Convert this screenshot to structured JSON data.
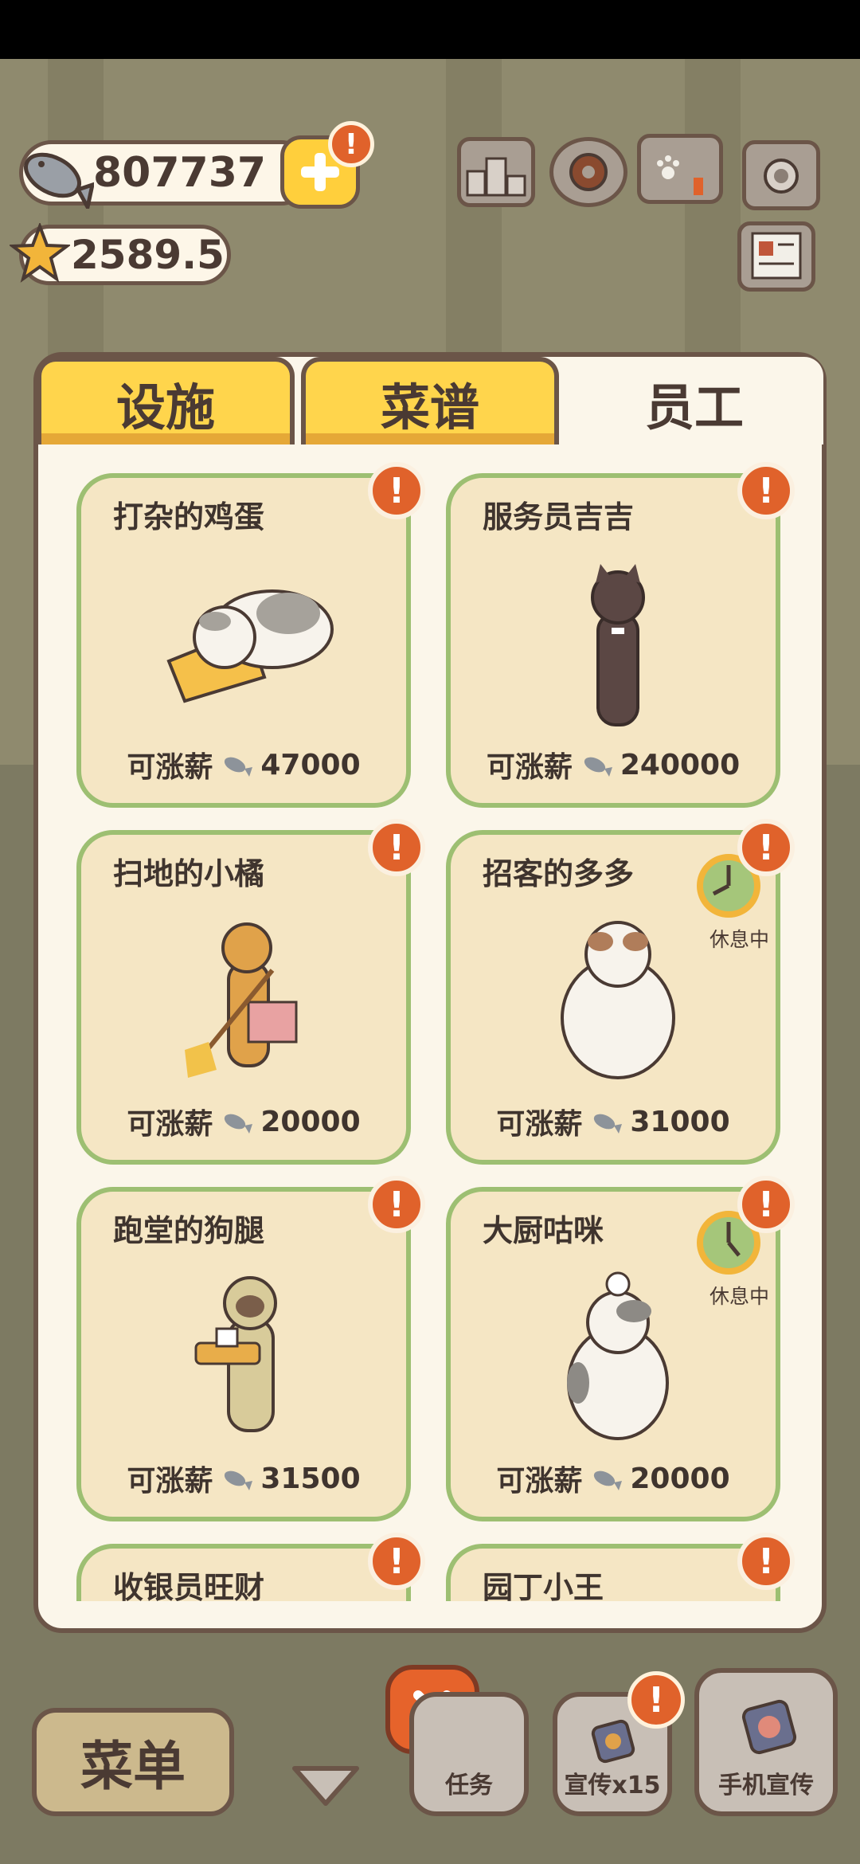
{
  "hud": {
    "fish_count": "807737",
    "star_count": "2589.5",
    "alert_mark": "!"
  },
  "tabs": [
    {
      "label": "设施",
      "active": false
    },
    {
      "label": "菜谱",
      "active": false
    },
    {
      "label": "员工",
      "active": true
    }
  ],
  "staff": [
    {
      "name": "打杂的鸡蛋",
      "salary_label": "可涨薪",
      "salary": "47000",
      "resting": false,
      "icon": "cat-on-mop-icon"
    },
    {
      "name": "服务员吉吉",
      "salary_label": "可涨薪",
      "salary": "240000",
      "resting": false,
      "icon": "waiter-cat-icon"
    },
    {
      "name": "扫地的小橘",
      "salary_label": "可涨薪",
      "salary": "20000",
      "resting": false,
      "icon": "sweeping-cat-icon"
    },
    {
      "name": "招客的多多",
      "salary_label": "可涨薪",
      "salary": "31000",
      "resting": true,
      "rest_label": "休息中",
      "icon": "fluffy-cat-icon"
    },
    {
      "name": "跑堂的狗腿",
      "salary_label": "可涨薪",
      "salary": "31500",
      "resting": false,
      "icon": "serving-cat-icon"
    },
    {
      "name": "大厨咕咪",
      "salary_label": "可涨薪",
      "salary": "20000",
      "resting": true,
      "rest_label": "休息中",
      "icon": "chef-cat-icon"
    },
    {
      "name": "收银员旺财",
      "partial": true
    },
    {
      "name": "园丁小王",
      "partial": true
    }
  ],
  "bottom": {
    "menu_label": "菜单",
    "tasks_label": "任务",
    "promo_label": "宣传x15",
    "phone_promo_label": "手机宣传"
  },
  "colors": {
    "panel_bg": "#fbf6ea",
    "card_bg": "#f5e6c4",
    "card_border": "#9dbf72",
    "tab_yellow": "#ffd54c",
    "alert_orange": "#e0622b",
    "outline": "#6b5548"
  }
}
